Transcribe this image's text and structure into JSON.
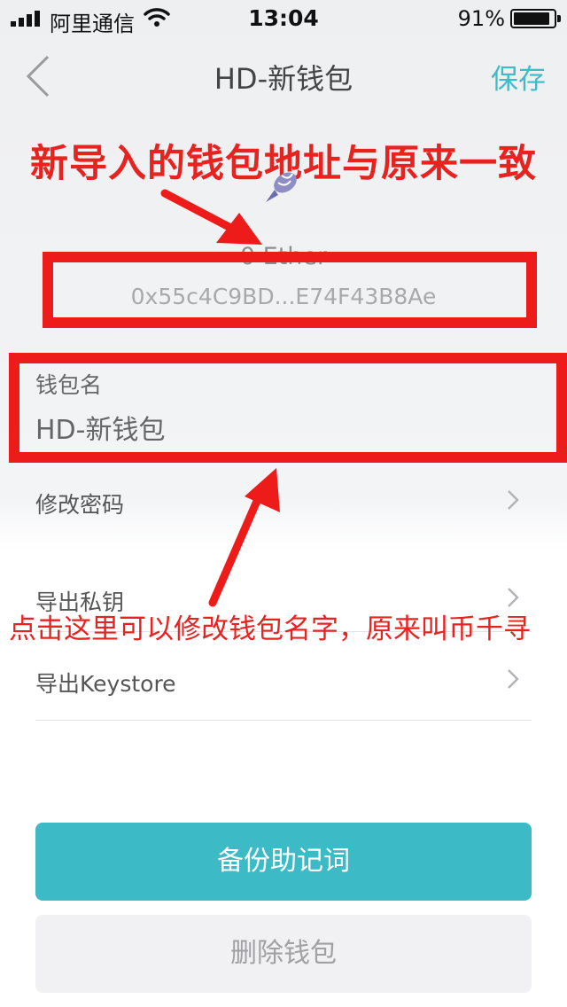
{
  "status_bar": {
    "carrier": "阿里通信",
    "time": "13:04",
    "battery": "91%",
    "battery_level": 0.91,
    "icons": [
      "signal-icon",
      "wifi-icon",
      "battery-icon"
    ]
  },
  "nav": {
    "title": "HD-新钱包",
    "save_label": "保存",
    "back_icon": "chevron-left-icon"
  },
  "annotations": {
    "top": "新导入的钱包地址与原来一致",
    "bottom": "点击这里可以修改钱包名字，原来叫币千寻",
    "color": "#e8231f"
  },
  "wallet": {
    "icon": "shell-icon",
    "balance": "0 Ether",
    "address": "0x55c4C9BD...E74F43B8Ae"
  },
  "name_field": {
    "label": "钱包名",
    "value": "HD-新钱包"
  },
  "menu": {
    "items": [
      {
        "label": "修改密码"
      },
      {
        "label": "导出私钥"
      },
      {
        "label": "导出Keystore"
      }
    ]
  },
  "buttons": {
    "backup_label": "备份助记词",
    "delete_label": "删除钱包"
  },
  "colors": {
    "accent": "#3cbac6",
    "annotation_red": "#ee1b1b"
  }
}
